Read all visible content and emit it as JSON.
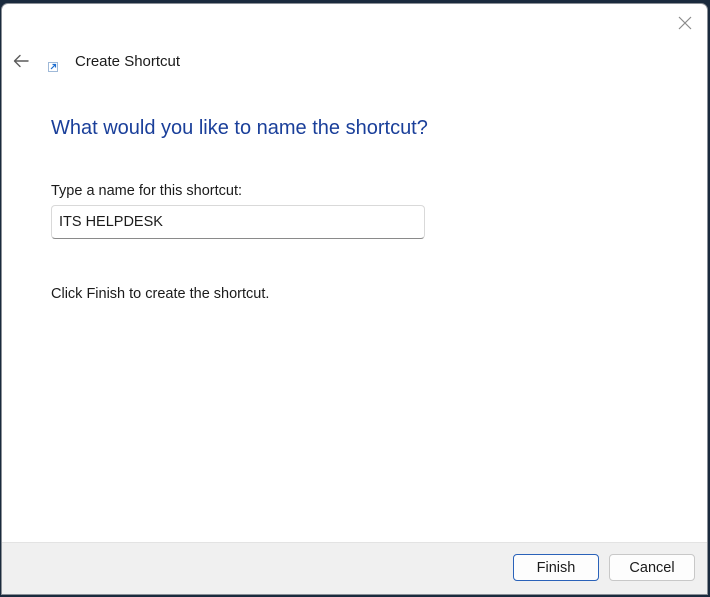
{
  "window": {
    "title": "Create Shortcut"
  },
  "page": {
    "heading": "What would you like to name the shortcut?",
    "name_label": "Type a name for this shortcut:",
    "name_value": "ITS HELPDESK",
    "instruction": "Click Finish to create the shortcut."
  },
  "footer": {
    "finish_label": "Finish",
    "cancel_label": "Cancel"
  },
  "icons": {
    "close": "close-icon",
    "back": "back-arrow-icon",
    "shortcut": "shortcut-icon"
  },
  "colors": {
    "heading": "#1a3f9a",
    "accent": "#2a62b9",
    "footer_bg": "#f0f0f0"
  }
}
